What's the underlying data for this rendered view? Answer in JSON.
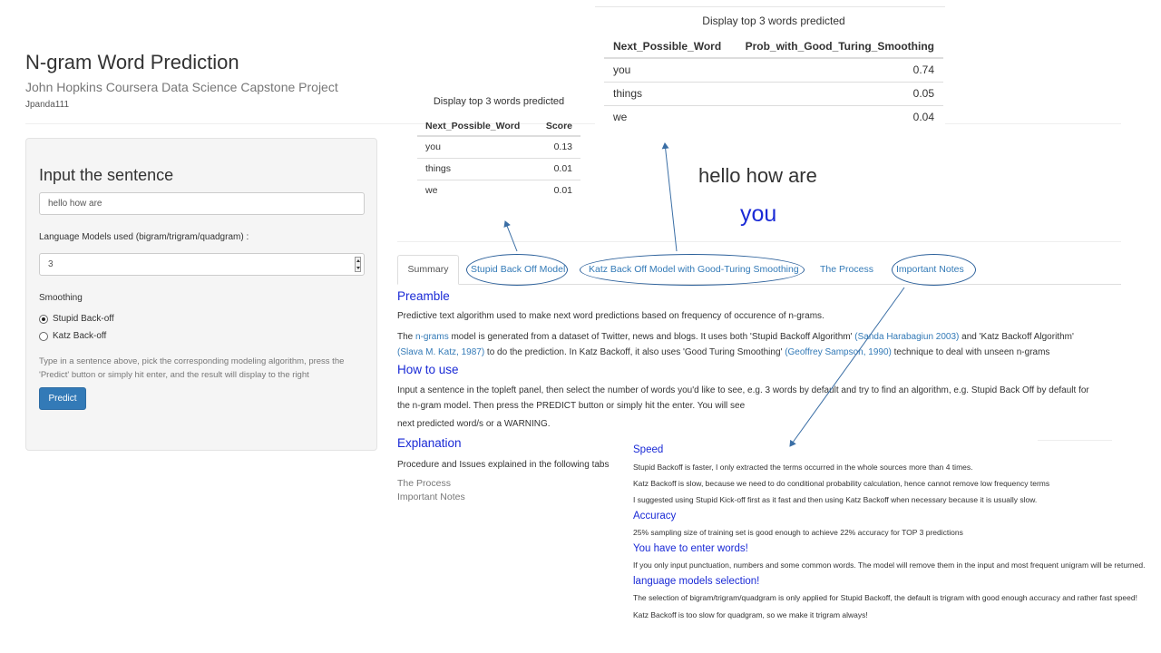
{
  "header": {
    "title": "N-gram Word Prediction",
    "subtitle": "John Hopkins Coursera Data Science Capstone Project",
    "author": "Jpanda111"
  },
  "sidebar": {
    "heading": "Input the sentence",
    "sentence_value": "hello how are",
    "models_label": "Language Models used (bigram/trigram/quadgram) :",
    "models_value": "3",
    "smoothing_label": "Smoothing",
    "options": [
      {
        "label": "Stupid Back-off",
        "checked": true
      },
      {
        "label": "Katz Back-off",
        "checked": false
      }
    ],
    "help_text": "Type in a sentence above, pick the corresponding modeling algorithm, press the 'Predict' button or simply hit enter, and the result will display to the right",
    "predict_label": "Predict"
  },
  "table_stupid": {
    "caption": "Display top 3 words predicted",
    "headers": [
      "Next_Possible_Word",
      "Score"
    ],
    "rows": [
      [
        "you",
        "0.13"
      ],
      [
        "things",
        "0.01"
      ],
      [
        "we",
        "0.01"
      ]
    ]
  },
  "table_katz": {
    "caption": "Display top 3 words predicted",
    "headers": [
      "Next_Possible_Word",
      "Prob_with_Good_Turing_Smoothing"
    ],
    "rows": [
      [
        "you",
        "0.74"
      ],
      [
        "things",
        "0.05"
      ],
      [
        "we",
        "0.04"
      ]
    ]
  },
  "result": {
    "input_echo": "hello how are",
    "predicted": "you"
  },
  "tabs": {
    "summary": "Summary",
    "stupid": "Stupid Back Off Model",
    "katz": "Katz Back Off Model with Good-Turing Smoothing",
    "process": "The Process",
    "notes": "Important Notes"
  },
  "summary": {
    "preamble_heading": "Preamble",
    "preamble_text": "Predictive text algorithm used to make next word predictions based on frequency of occurence of n-grams.",
    "p2_the": "The ",
    "p2_link_ngrams": "n-grams",
    "p2_a": " model is generated from a dataset of Twitter, news and blogs. It uses both 'Stupid Backoff Algorithm' ",
    "p2_link_sanda": "(Sanda Harabagiun 2003)",
    "p2_b": " and 'Katz Backoff Algorithm'",
    "p2_link_katz": "(Slava M. Katz, 1987)",
    "p2_c": " to do the prediction. In Katz Backoff, it also uses 'Good Turing Smoothing' ",
    "p2_link_sampson": "(Geoffrey Sampson, 1990)",
    "p2_d": " technique to deal with unseen n-grams",
    "howto_heading": "How to use",
    "howto_line1": "Input a sentence in the topleft panel, then select the number of words you'd like to see, e.g. 3 words by default and try to find an algorithm, e.g. Stupid Back Off by default for",
    "howto_line2": "the n-gram model. Then press the PREDICT button or simply hit the enter. You will see",
    "howto_line3": "next predicted word/s or a WARNING.",
    "explanation_heading": "Explanation",
    "explanation_text": "Procedure and Issues explained in the following tabs",
    "link_process": "The Process",
    "link_notes": "Important Notes"
  },
  "notes": {
    "speed_heading": "Speed",
    "speed_1": "Stupid Backoff is faster, I only extracted the terms occurred in the whole sources more than 4 times.",
    "speed_2": "Katz Backoff is slow, because we need to do conditional probability calculation, hence cannot remove low frequency terms",
    "speed_3": "I suggested using Stupid Kick-off first as it fast and then using Katz Backoff when necessary because it is usually slow.",
    "accuracy_heading": "Accuracy",
    "accuracy_1": "25% sampling size of training set is good enough to achieve 22% accuracy for TOP 3 predictions",
    "enter_heading": "You have to enter words!",
    "enter_1": "If you only input punctuation, numbers and some common words. The model will remove them in the input and most frequent unigram will be returned.",
    "lm_heading": "language models selection!",
    "lm_1": "The selection of bigram/trigram/quadgram is only applied for Stupid Backoff, the default is trigram with good enough accuracy and rather fast speed!",
    "lm_2": "Katz Backoff is too slow for quadgram, so we make it trigram always!"
  },
  "colors": {
    "accent_blue": "#1a2ad6",
    "link_blue": "#337ab7",
    "annotation_stroke": "#2a5f9a",
    "button_blue": "#337ab7"
  }
}
